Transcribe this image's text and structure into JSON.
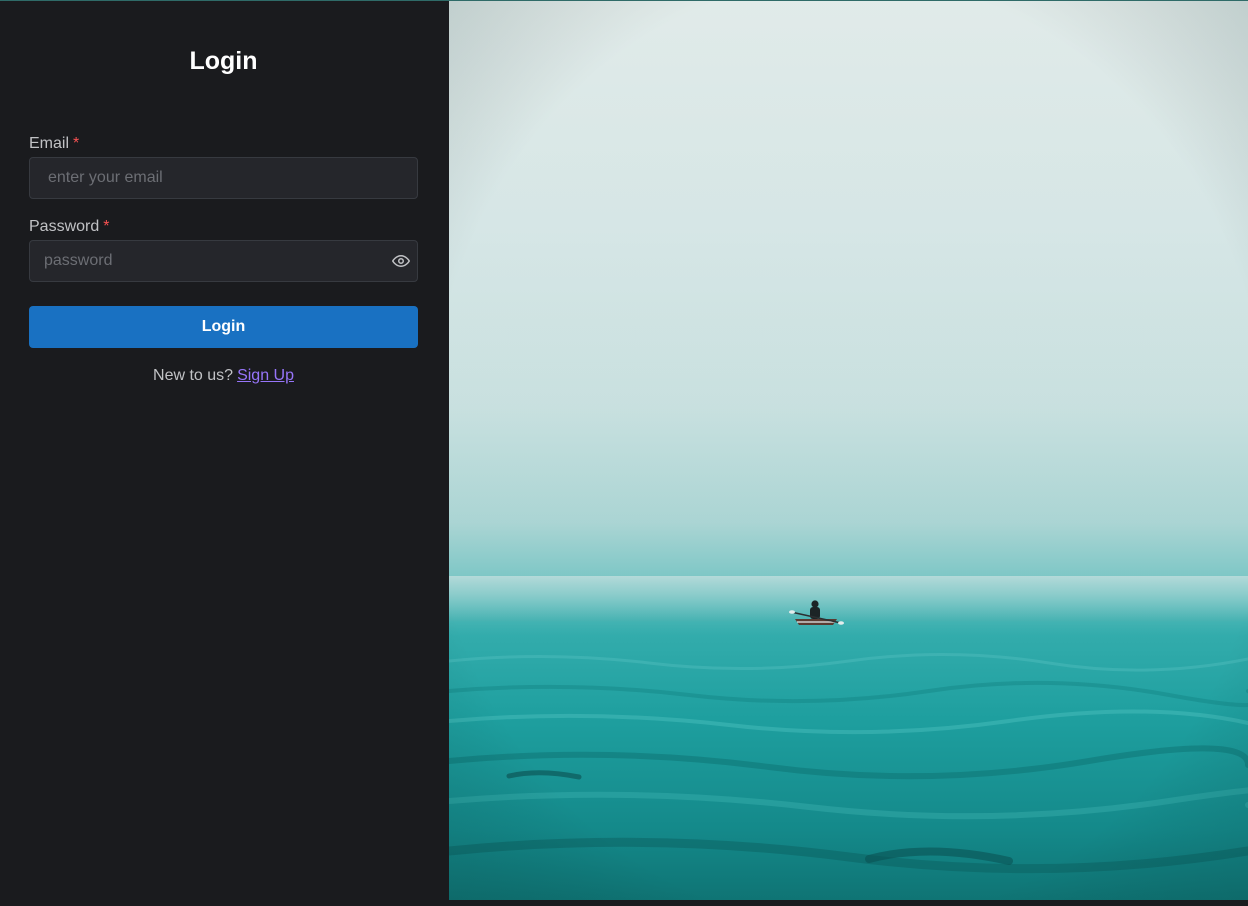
{
  "login_form": {
    "title": "Login",
    "email": {
      "label": "Email",
      "required_mark": "*",
      "placeholder": "enter your email",
      "value": ""
    },
    "password": {
      "label": "Password",
      "required_mark": "*",
      "placeholder": "password",
      "value": "",
      "toggle_icon": "eye-icon"
    },
    "submit_label": "Login",
    "signup_prompt": "New to us?",
    "signup_link": "Sign Up"
  },
  "colors": {
    "background": "#1a1b1e",
    "input_background": "#25262b",
    "primary_button": "#1971c2",
    "required": "#fa5252",
    "link": "#9775fa"
  }
}
